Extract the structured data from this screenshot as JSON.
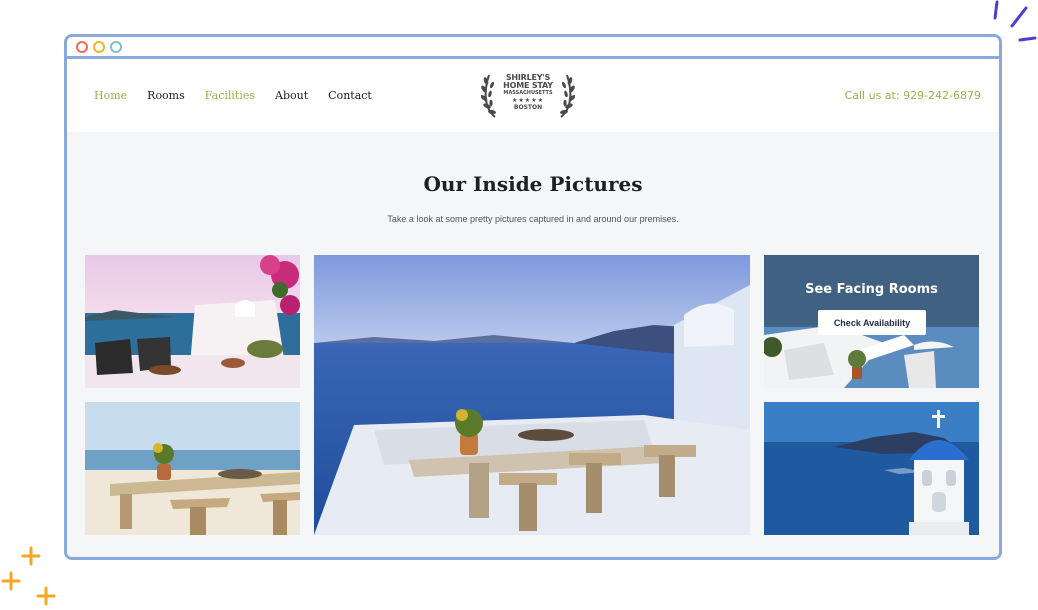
{
  "nav": {
    "items": [
      {
        "label": "Home",
        "active": true
      },
      {
        "label": "Rooms",
        "active": false
      },
      {
        "label": "Facilities",
        "active": true
      },
      {
        "label": "About",
        "active": false
      },
      {
        "label": "Contact",
        "active": false
      }
    ]
  },
  "logo": {
    "line1": "SHIRLEY'S",
    "line2": "HOME STAY",
    "line3": "MASSACHUSETTS",
    "stars": "★★★★★",
    "line4": "BOSTON"
  },
  "phone": "Call us at: 929-242-6879",
  "gallery": {
    "title": "Our Inside Pictures",
    "subtitle": "Take a look at some pretty pictures captured in and around our premises."
  },
  "card": {
    "title": "See Facing Rooms",
    "button": "Check Availability"
  },
  "colors": {
    "accent": "#9bb04a",
    "window_border": "#89a8dc",
    "text_dark": "#1f1f1f"
  }
}
